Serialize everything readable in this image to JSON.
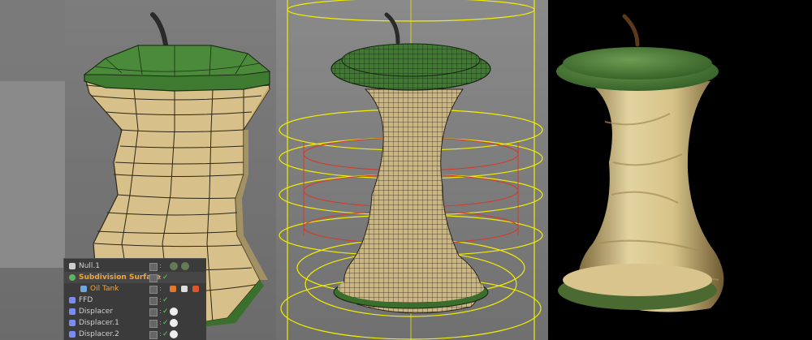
{
  "object_manager": {
    "rows": [
      {
        "label": "Null.1",
        "style": "normal"
      },
      {
        "label": "Subdivision Surface",
        "style": "active"
      },
      {
        "label": "Oil Tank",
        "style": "child"
      },
      {
        "label": "FFD",
        "style": "normal"
      },
      {
        "label": "Displacer",
        "style": "normal"
      },
      {
        "label": "Displacer.1",
        "style": "normal"
      },
      {
        "label": "Displacer.2",
        "style": "normal"
      }
    ]
  },
  "colors": {
    "viewport_bg": "#757575",
    "render_bg": "#000000",
    "apple_skin": "#3c7a2f",
    "apple_flesh": "#d8c48a",
    "wireframe_cage": "#f5f000",
    "deformer_red": "#d33a2a",
    "active_object": "#f3a53a",
    "enabled_check": "#5fd35f"
  },
  "icons": [
    "null-object-icon",
    "subdivision-icon",
    "polygon-object-icon",
    "ffd-icon",
    "displacer-icon",
    "checkmark-icon",
    "material-tag-icon",
    "phong-tag-icon",
    "texture-tag-icon"
  ]
}
